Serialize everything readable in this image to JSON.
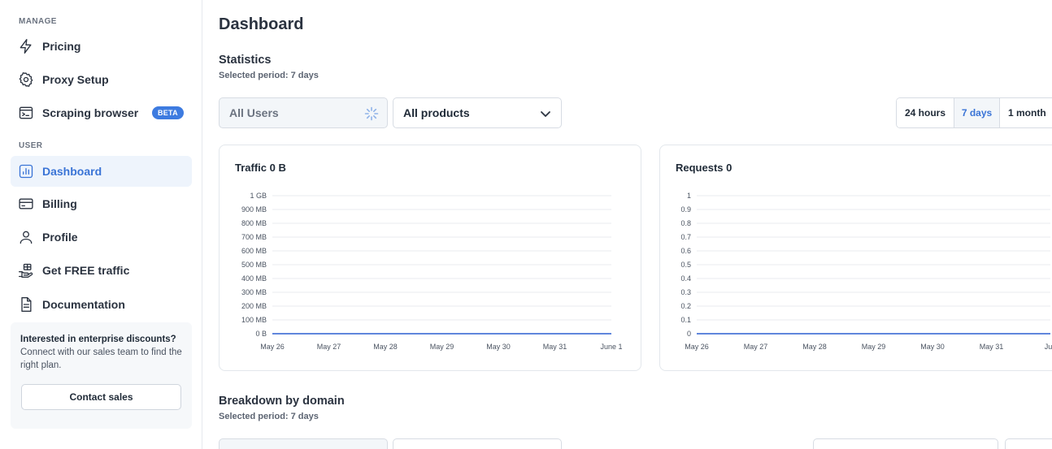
{
  "sidebar": {
    "manage_label": "MANAGE",
    "manage_items": [
      {
        "label": "Pricing",
        "icon": "bolt-icon"
      },
      {
        "label": "Proxy Setup",
        "icon": "gear-icon"
      },
      {
        "label": "Scraping browser",
        "icon": "terminal-icon",
        "badge": "BETA"
      }
    ],
    "user_label": "USER",
    "user_items": [
      {
        "label": "Dashboard",
        "icon": "bar-chart-icon",
        "active": true
      },
      {
        "label": "Billing",
        "icon": "credit-card-icon"
      },
      {
        "label": "Profile",
        "icon": "user-icon"
      },
      {
        "label": "Get FREE traffic",
        "icon": "gift-hand-icon"
      },
      {
        "label": "Documentation",
        "icon": "document-icon"
      }
    ],
    "promo": {
      "heading": "Interested in enterprise discounts?",
      "body": "Connect with our sales team to find the right plan.",
      "button": "Contact sales"
    }
  },
  "main": {
    "title": "Dashboard",
    "statistics": {
      "title": "Statistics",
      "subtitle": "Selected period: 7 days",
      "users_select": "All Users",
      "products_select": "All products",
      "periods": [
        "24 hours",
        "7 days",
        "1 month"
      ],
      "selected_period": "7 days"
    },
    "breakdown": {
      "title": "Breakdown by domain",
      "subtitle": "Selected period: 7 days"
    }
  },
  "colors": {
    "accent": "#3a74d6",
    "line": "#2b5fd1",
    "badge": "#3d7be0"
  },
  "chart_data": [
    {
      "type": "line",
      "title": "Traffic 0 B",
      "x": [
        "May 26",
        "May 27",
        "May 28",
        "May 29",
        "May 30",
        "May 31",
        "June 1"
      ],
      "y_ticks": [
        "0 B",
        "100 MB",
        "200 MB",
        "300 MB",
        "400 MB",
        "500 MB",
        "600 MB",
        "700 MB",
        "800 MB",
        "900 MB",
        "1 GB"
      ],
      "series": [
        {
          "values": [
            0,
            0,
            0,
            0,
            0,
            0,
            0
          ]
        }
      ],
      "ylim": [
        0,
        1
      ],
      "grid": true
    },
    {
      "type": "line",
      "title": "Requests 0",
      "x": [
        "May 26",
        "May 27",
        "May 28",
        "May 29",
        "May 30",
        "May 31",
        "Jun"
      ],
      "y_ticks": [
        "0",
        "0.1",
        "0.2",
        "0.3",
        "0.4",
        "0.5",
        "0.6",
        "0.7",
        "0.8",
        "0.9",
        "1"
      ],
      "series": [
        {
          "values": [
            0,
            0,
            0,
            0,
            0,
            0,
            0
          ]
        }
      ],
      "ylim": [
        0,
        1
      ],
      "grid": true
    }
  ]
}
